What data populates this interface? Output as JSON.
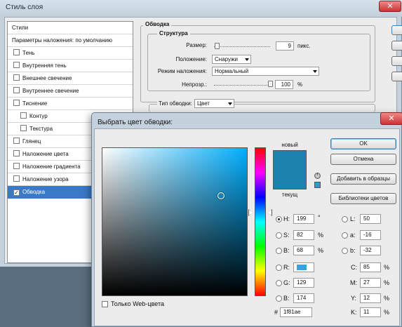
{
  "layer_style": {
    "title": "Стиль слоя",
    "close_glyph": "✕",
    "list": [
      {
        "label": "Стили",
        "type": "head",
        "checked": false
      },
      {
        "label": "Параметры наложения: по умолчанию",
        "type": "head",
        "checked": false
      },
      {
        "label": "Тень",
        "type": "item",
        "checked": false
      },
      {
        "label": "Внутренняя тень",
        "type": "item",
        "checked": false
      },
      {
        "label": "Внешнее свечение",
        "type": "item",
        "checked": false
      },
      {
        "label": "Внутреннее свечение",
        "type": "item",
        "checked": false
      },
      {
        "label": "Тиснение",
        "type": "item",
        "checked": false
      },
      {
        "label": "Контур",
        "type": "sub",
        "checked": false
      },
      {
        "label": "Текстура",
        "type": "sub",
        "checked": false
      },
      {
        "label": "Глянец",
        "type": "item",
        "checked": false
      },
      {
        "label": "Наложение цвета",
        "type": "item",
        "checked": false
      },
      {
        "label": "Наложение градиента",
        "type": "item",
        "checked": false
      },
      {
        "label": "Наложение узора",
        "type": "item",
        "checked": false
      },
      {
        "label": "Обводка",
        "type": "item",
        "checked": true,
        "selected": true
      }
    ],
    "stroke": {
      "section_title": "Обводка",
      "structure_title": "Структура",
      "size_label": "Размер:",
      "size_value": "9",
      "size_unit": "пикс.",
      "size_slider_fraction": 0.05,
      "position_label": "Положение:",
      "position_value": "Снаружи",
      "blend_label": "Режим наложения:",
      "blend_value": "Нормальный",
      "opacity_label": "Непрозр.:",
      "opacity_value": "100",
      "opacity_unit": "%",
      "opacity_slider_fraction": 1.0,
      "fill_type_label": "Тип обводки:",
      "fill_type_value": "Цвет"
    }
  },
  "color_picker": {
    "title": "Выбрать цвет обводки:",
    "close_glyph": "✕",
    "new_label": "новый",
    "current_label": "текущ",
    "new_color": "#1f81ae",
    "current_color": "#1f81ae",
    "websafe_color": "#3399cc",
    "gamut_icon": "cube-warning-icon",
    "gamut_glyph": "!",
    "buttons": {
      "ok": "OK",
      "cancel": "Отмена",
      "add_swatches": "Добавить в образцы",
      "libraries": "Библиотеки цветов"
    },
    "hsb": {
      "h_label": "H:",
      "h_value": "199",
      "h_unit": "°",
      "s_label": "S:",
      "s_value": "82",
      "s_unit": "%",
      "b_label": "B:",
      "b_value": "68",
      "b_unit": "%"
    },
    "rgb": {
      "r_label": "R:",
      "r_value": "",
      "g_label": "G:",
      "g_value": "129",
      "b_label": "B:",
      "b_value": "174"
    },
    "lab": {
      "l_label": "L:",
      "l_value": "50",
      "a_label": "a:",
      "a_value": "-16",
      "b_label": "b:",
      "b_value": "-32"
    },
    "cmyk": {
      "c_label": "C:",
      "c_value": "85",
      "c_unit": "%",
      "m_label": "M:",
      "m_value": "27",
      "m_unit": "%",
      "y_label": "Y:",
      "y_value": "12",
      "y_unit": "%",
      "k_label": "K:",
      "k_value": "11",
      "k_unit": "%"
    },
    "hex_label": "#",
    "hex_value": "1f81ae",
    "web_only_label": "Только Web-цвета",
    "web_only_checked": false,
    "selected_mode": "H"
  }
}
